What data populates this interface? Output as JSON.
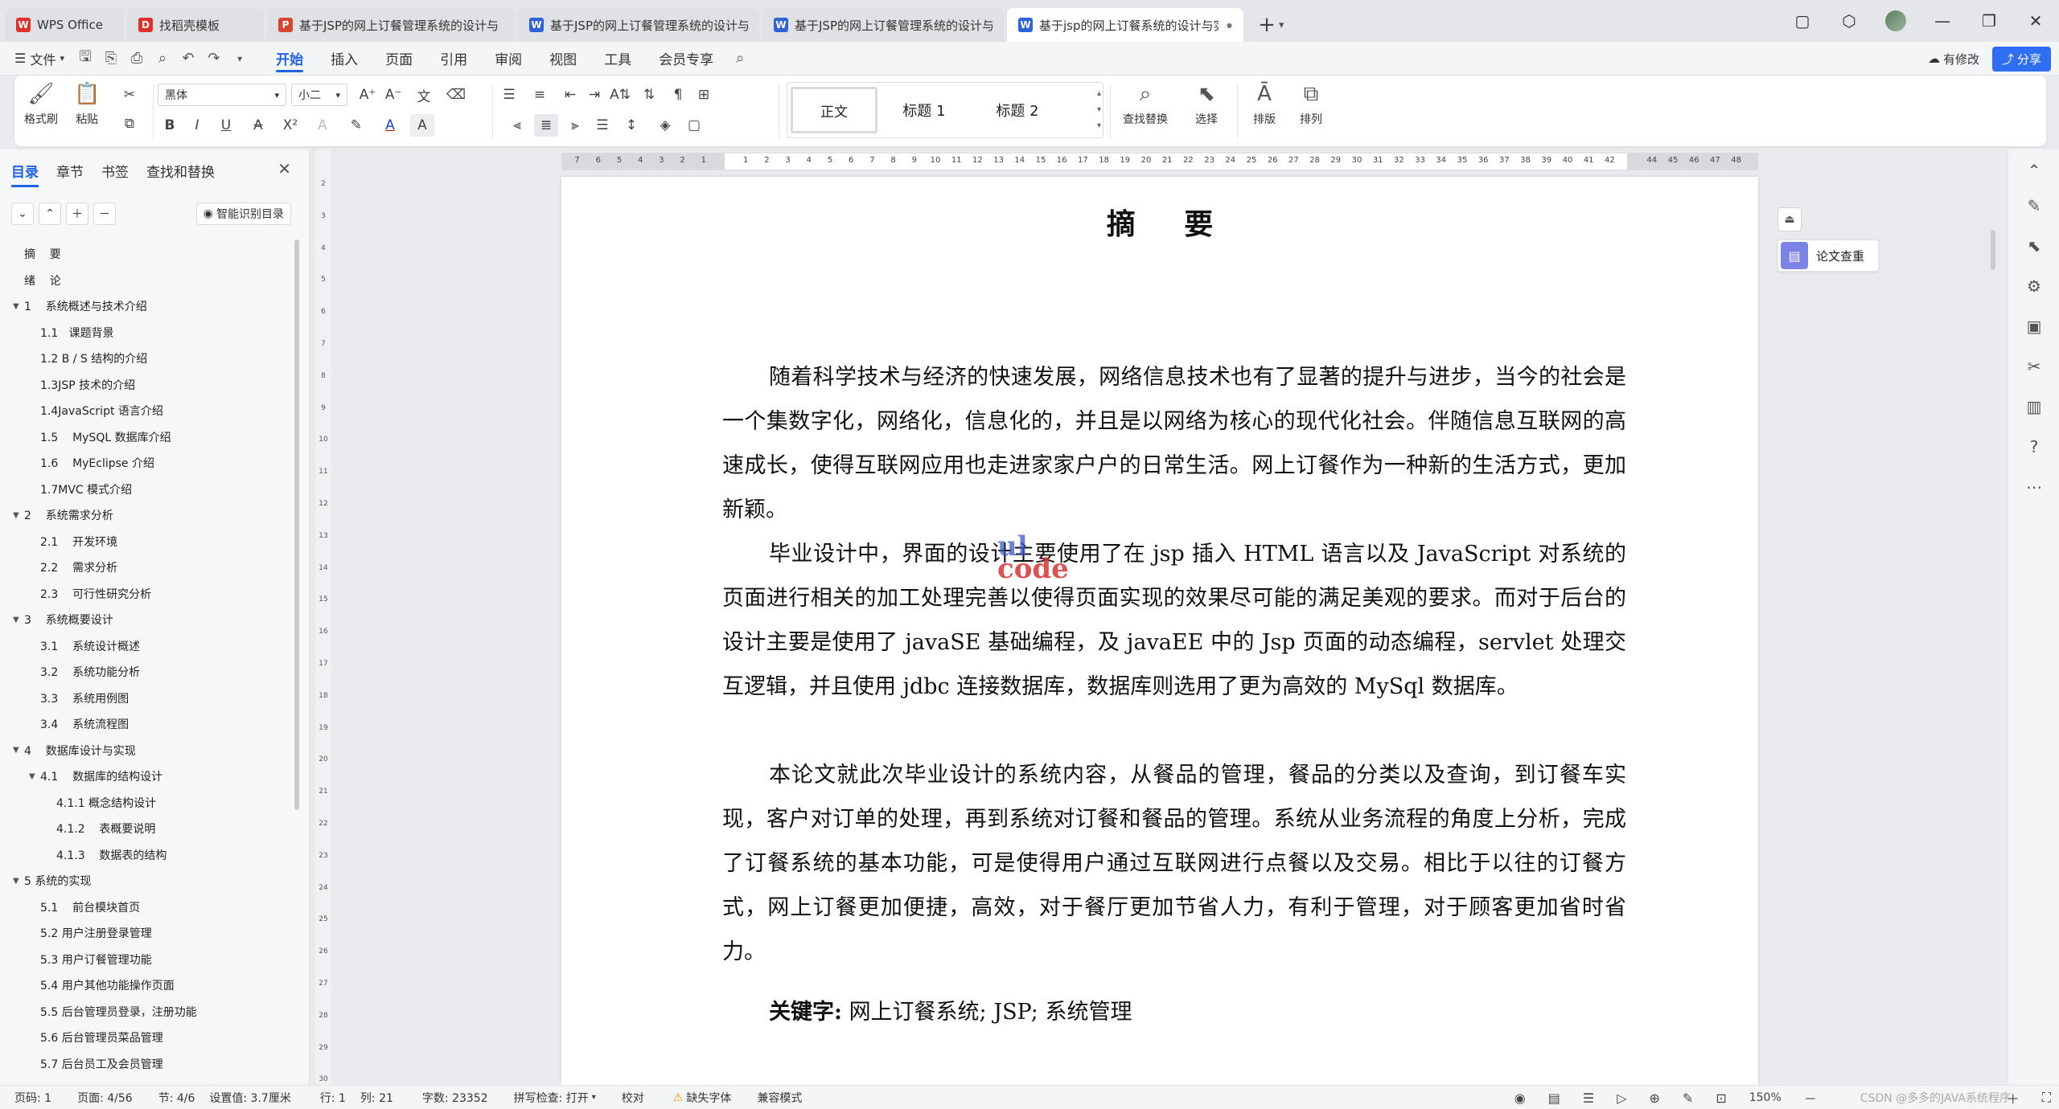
{
  "tabs": [
    {
      "label": "WPS Office",
      "icon": "wps-logo-icon",
      "color": "#e0302a",
      "glyph": "W",
      "width": 148
    },
    {
      "label": "找稻壳模板",
      "icon": "docer-icon",
      "color": "#e0302a",
      "glyph": "D",
      "width": 170
    },
    {
      "label": "基于JSP的网上订餐管理系统的设计与",
      "icon": "ppt-icon",
      "color": "#d9462f",
      "glyph": "P",
      "width": 308
    },
    {
      "label": "基于JSP的网上订餐管理系统的设计与",
      "icon": "word-doc-icon",
      "color": "#2f62d8",
      "glyph": "W",
      "width": 300
    },
    {
      "label": "基于JSP的网上订餐管理系统的设计与",
      "icon": "word-doc-icon",
      "color": "#2f62d8",
      "glyph": "W",
      "width": 300
    },
    {
      "label": "基于jsp的网上订餐系统的设计与实",
      "icon": "word-doc-icon",
      "color": "#2f62d8",
      "glyph": "W",
      "width": 294,
      "active": true
    }
  ],
  "menu": {
    "file": "文件",
    "items": [
      "开始",
      "插入",
      "页面",
      "引用",
      "审阅",
      "视图",
      "工具",
      "会员专享"
    ],
    "active": "开始",
    "modified": "有修改",
    "share": "分享"
  },
  "ribbon": {
    "format_painter": "格式刷",
    "paste": "粘贴",
    "font_name": "黑体",
    "font_size": "小二",
    "styles": {
      "normal": "正文",
      "h1": "标题 1",
      "h2": "标题 2"
    },
    "find_replace": "查找替换",
    "select": "选择",
    "layout": "排版",
    "arrange": "排列"
  },
  "nav": {
    "tabs": [
      "目录",
      "章节",
      "书签",
      "查找和替换"
    ],
    "active_tab": "目录",
    "smart_toc": "智能识别目录",
    "toc": [
      {
        "text": "摘    要",
        "level": 0
      },
      {
        "text": "绪    论",
        "level": 0
      },
      {
        "text": "1    系统概述与技术介绍",
        "level": 0,
        "caret": true
      },
      {
        "text": "1.1   课题背景",
        "level": 1
      },
      {
        "text": "1.2 B / S 结构的介绍",
        "level": 1
      },
      {
        "text": "1.3JSP 技术的介绍",
        "level": 1
      },
      {
        "text": "1.4JavaScript 语言介绍",
        "level": 1
      },
      {
        "text": "1.5    MySQL 数据库介绍",
        "level": 1
      },
      {
        "text": "1.6    MyEclipse 介绍",
        "level": 1
      },
      {
        "text": "1.7MVC 模式介绍",
        "level": 1
      },
      {
        "text": "2    系统需求分析",
        "level": 0,
        "caret": true
      },
      {
        "text": "2.1    开发环境",
        "level": 1
      },
      {
        "text": "2.2    需求分析",
        "level": 1
      },
      {
        "text": "2.3    可行性研究分析",
        "level": 1
      },
      {
        "text": "3    系统概要设计",
        "level": 0,
        "caret": true
      },
      {
        "text": "3.1    系统设计概述",
        "level": 1
      },
      {
        "text": "3.2    系统功能分析",
        "level": 1
      },
      {
        "text": "3.3    系统用例图",
        "level": 1
      },
      {
        "text": "3.4    系统流程图",
        "level": 1
      },
      {
        "text": "4    数据库设计与实现",
        "level": 0,
        "caret": true
      },
      {
        "text": "4.1    数据库的结构设计",
        "level": 1,
        "caret": true
      },
      {
        "text": "4.1.1 概念结构设计",
        "level": 2
      },
      {
        "text": "4.1.2    表概要说明",
        "level": 2
      },
      {
        "text": "4.1.3    数据表的结构",
        "level": 2
      },
      {
        "text": "5 系统的实现",
        "level": 0,
        "caret": true
      },
      {
        "text": "5.1    前台模块首页",
        "level": 1
      },
      {
        "text": "5.2 用户注册登录管理",
        "level": 1
      },
      {
        "text": "5.3 用户订餐管理功能",
        "level": 1
      },
      {
        "text": "5.4 用户其他功能操作页面",
        "level": 1
      },
      {
        "text": "5.5 后台管理员登录，注册功能",
        "level": 1
      },
      {
        "text": "5.6 后台管理员菜品管理",
        "level": 1
      },
      {
        "text": "5.7 后台员工及会员管理",
        "level": 1
      }
    ]
  },
  "document": {
    "title": "摘  要",
    "paragraphs": [
      "随着科学技术与经济的快速发展，网络信息技术也有了显著的提升与进步，当今的社会是一个集数字化，网络化，信息化的，并且是以网络为核心的现代化社会。伴随信息互联网的高速成长，使得互联网应用也走进家家户户的日常生活。网上订餐作为一种新的生活方式，更加新颖。",
      "毕业设计中，界面的设计主要使用了在 jsp 插入 HTML 语言以及 JavaScript 对系统的页面进行相关的加工处理完善以使得页面实现的效果尽可能的满足美观的要求。而对于后台的设计主要是使用了 javaSE 基础编程，及 javaEE 中的 Jsp 页面的动态编程，servlet 处理交互逻辑，并且使用 jdbc 连接数据库，数据库则选用了更为高效的 MySql 数据库。",
      "本论文就此次毕业设计的系统内容，从餐品的管理，餐品的分类以及查询，到订餐车实现，客户对订单的处理，再到系统对订餐和餐品的管理。系统从业务流程的角度上分析，完成了订餐系统的基本功能，可是使得用户通过互联网进行点餐以及交易。相比于以往的订餐方式，网上订餐更加便捷，高效，对于餐厅更加节省人力，有利于管理，对于顾客更加省时省力。"
    ],
    "keywords_label": "关键字:",
    "keywords_value": "网上订餐系统; JSP; 系统管理",
    "watermark_top": "ul",
    "watermark_bottom": "code"
  },
  "ruler": {
    "h_left": [
      "7",
      "6",
      "5",
      "4",
      "3",
      "2",
      "1"
    ],
    "h_right": [
      "1",
      "2",
      "3",
      "4",
      "5",
      "6",
      "7",
      "8",
      "9",
      "10",
      "11",
      "12",
      "13",
      "14",
      "15",
      "16",
      "17",
      "18",
      "19",
      "20",
      "21",
      "22",
      "23",
      "24",
      "25",
      "26",
      "27",
      "28",
      "29",
      "30",
      "31",
      "32",
      "33",
      "34",
      "35",
      "36",
      "37",
      "38",
      "39",
      "40",
      "41",
      "42",
      "44",
      "45",
      "46",
      "47",
      "48"
    ],
    "v": [
      "2",
      "3",
      "4",
      "5",
      "6",
      "7",
      "8",
      "9",
      "10",
      "11",
      "12",
      "13",
      "14",
      "15",
      "16",
      "17",
      "18",
      "19",
      "20",
      "21",
      "22",
      "23",
      "24",
      "25",
      "26",
      "27",
      "28",
      "29",
      "30"
    ]
  },
  "plagiarism": "论文查重",
  "status": {
    "page_code": "页码: 1",
    "page": "页面: 4/56",
    "section": "节: 4/6",
    "setting": "设置值: 3.7厘米",
    "row": "行: 1",
    "col": "列: 21",
    "word_count": "字数: 23352",
    "spell_check": "拼写检查: 打开",
    "proofread": "校对",
    "missing_font": "缺失字体",
    "compat": "兼容模式",
    "zoom": "150%",
    "watermark": "CSDN @多多的JAVA系统程序"
  }
}
